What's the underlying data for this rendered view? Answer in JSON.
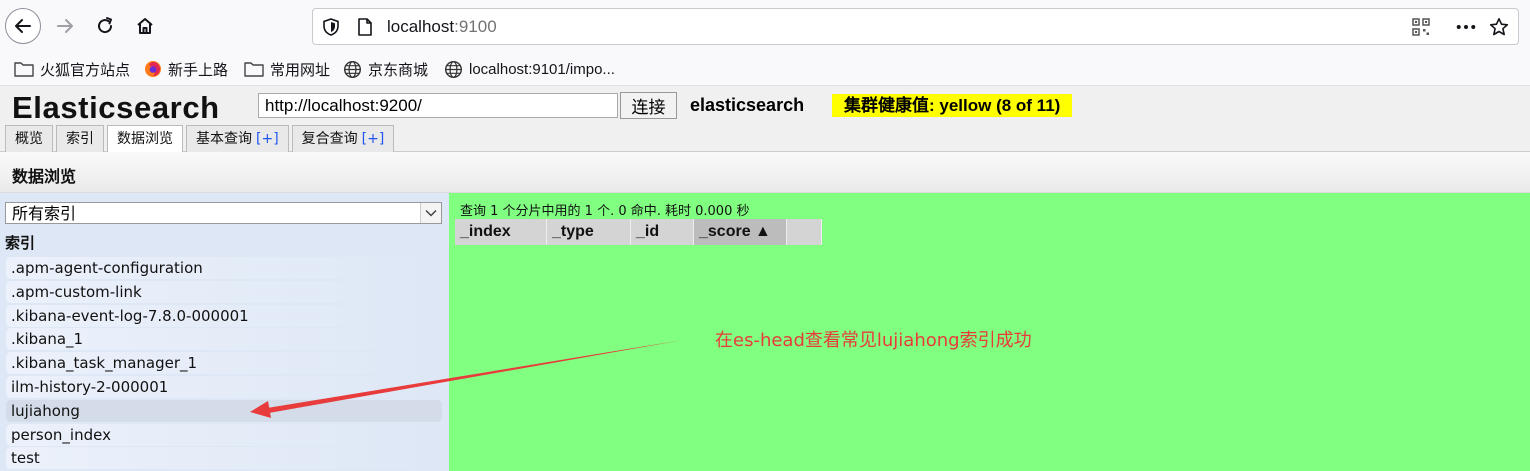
{
  "browser": {
    "url_host": "localhost",
    "url_port": ":9100",
    "bookmarks": [
      {
        "label": "火狐官方站点",
        "icon": "folder-icon"
      },
      {
        "label": "新手上路",
        "icon": "firefox-icon"
      },
      {
        "label": "常用网址",
        "icon": "folder-icon"
      },
      {
        "label": "京东商城",
        "icon": "globe-icon"
      },
      {
        "label": "localhost:9101/impo...",
        "icon": "globe-icon"
      }
    ]
  },
  "header": {
    "app_title": "Elasticsearch",
    "cluster_url": "http://localhost:9200/",
    "connect_label": "连接",
    "cluster_name": "elasticsearch",
    "health": "集群健康值: yellow (8 of 11)",
    "health_color": "#ffff00"
  },
  "tabs": [
    {
      "label": "概览",
      "plus": ""
    },
    {
      "label": "索引",
      "plus": ""
    },
    {
      "label": "数据浏览",
      "plus": "",
      "active": true
    },
    {
      "label": "基本查询",
      "plus": "[+]"
    },
    {
      "label": "复合查询",
      "plus": "[+]"
    }
  ],
  "section": {
    "title": "数据浏览"
  },
  "sidebar": {
    "select_value": "所有索引",
    "heading": "索引",
    "indices": [
      ".apm-agent-configuration",
      ".apm-custom-link",
      ".kibana-event-log-7.8.0-000001",
      ".kibana_1",
      ".kibana_task_manager_1",
      "ilm-history-2-000001",
      "lujiahong",
      "person_index",
      "test"
    ],
    "selected_index": "lujiahong"
  },
  "results": {
    "summary": "查询 1 个分片中用的 1 个. 0 命中. 耗时 0.000 秒",
    "columns": [
      "_index",
      "_type",
      "_id",
      "_score ▲"
    ],
    "sorted_column": "_score ▲",
    "background": "#80ff80"
  },
  "annotation": {
    "text": "在es-head查看常见lujiahong索引成功",
    "color": "#e83b3b"
  }
}
